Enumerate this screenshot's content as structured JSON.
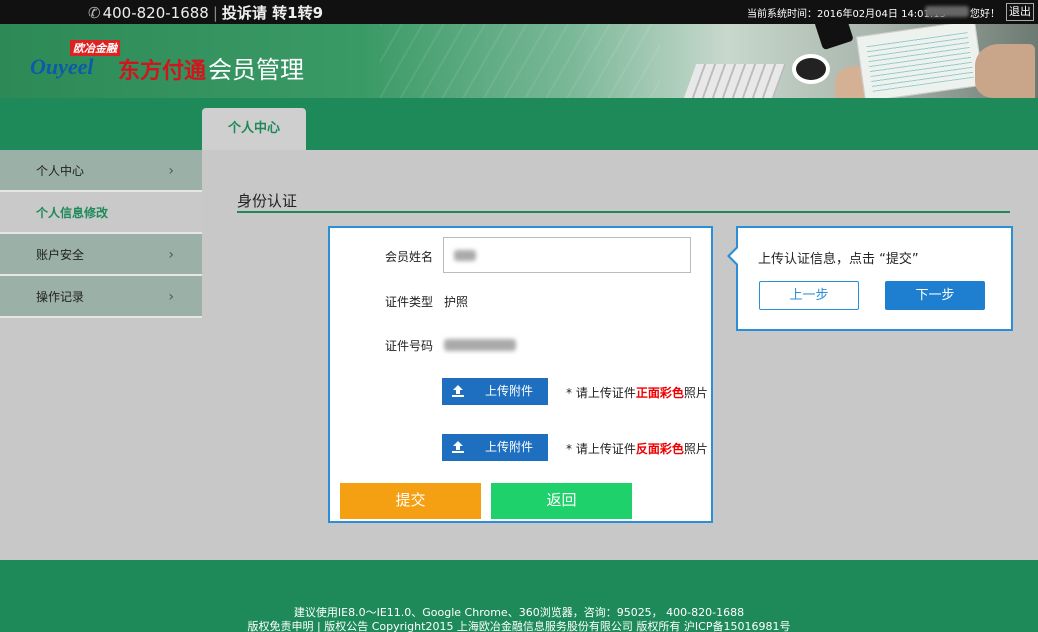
{
  "topbar": {
    "phone": "400-820-1688",
    "complaint": "投诉请 转1转9",
    "system_time": "当前系统时间：2016年02月04日 14:01:15",
    "greeting": "您好！",
    "logout": "退出"
  },
  "banner": {
    "logo_small": "欧冶金融",
    "logo_en": "Ouyeel",
    "logo_cn": "东方付通",
    "title": "会员管理"
  },
  "tab": {
    "label": "个人中心"
  },
  "sidebar": {
    "items": [
      {
        "label": "个人中心",
        "has_arrow": true
      },
      {
        "label": "个人信息修改",
        "active": true
      },
      {
        "label": "账户安全",
        "has_arrow": true
      },
      {
        "label": "操作记录",
        "has_arrow": true
      }
    ]
  },
  "main": {
    "section_title": "身份认证",
    "form": {
      "name_label": "会员姓名",
      "id_type_label": "证件类型",
      "id_type_value": "护照",
      "id_number_label": "证件号码",
      "upload_label_1": "上传附件",
      "note1_prefix": "* 请上传证件",
      "note1_red": "正面彩色",
      "note1_suffix": "照片",
      "upload_label_2": "上传附件",
      "note2_prefix": "* 请上传证件",
      "note2_red": "反面彩色",
      "note2_suffix": "照片",
      "submit": "提交",
      "back": "返回"
    }
  },
  "tooltip": {
    "text": "上传认证信息，点击 “提交”",
    "prev": "上一步",
    "next": "下一步"
  },
  "footer": {
    "line1": "建议使用IE8.0～IE11.0、Google Chrome、360浏览器，咨询：95025， 400-820-1688",
    "line2": "版权免责申明 | 版权公告 Copyright2015 上海欧冶金融信息服务股份有限公司 版权所有 沪ICP备15016981号"
  },
  "colors": {
    "brand_green": "#1e8a5a",
    "accent_blue": "#2a8fd6",
    "submit_orange": "#f5a012",
    "back_green": "#1ed16a"
  }
}
